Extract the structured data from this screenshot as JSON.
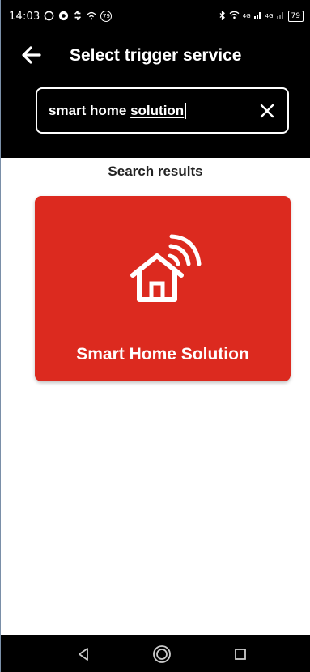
{
  "status_bar": {
    "time": "14:03",
    "notification_badge": "79",
    "network_label": "4G",
    "network_label_2": "4G",
    "battery_level": "79"
  },
  "header": {
    "title": "Select trigger service"
  },
  "search": {
    "query_prefix": "smart home ",
    "query_word": "solution"
  },
  "results": {
    "heading": "Search results",
    "items": [
      {
        "label": "Smart Home Solution",
        "color": "#dc2a1f",
        "icon": "smart-home-icon"
      }
    ]
  },
  "nav": {
    "back": "nav-back-icon",
    "home": "nav-home-icon",
    "recents": "nav-recents-icon"
  }
}
